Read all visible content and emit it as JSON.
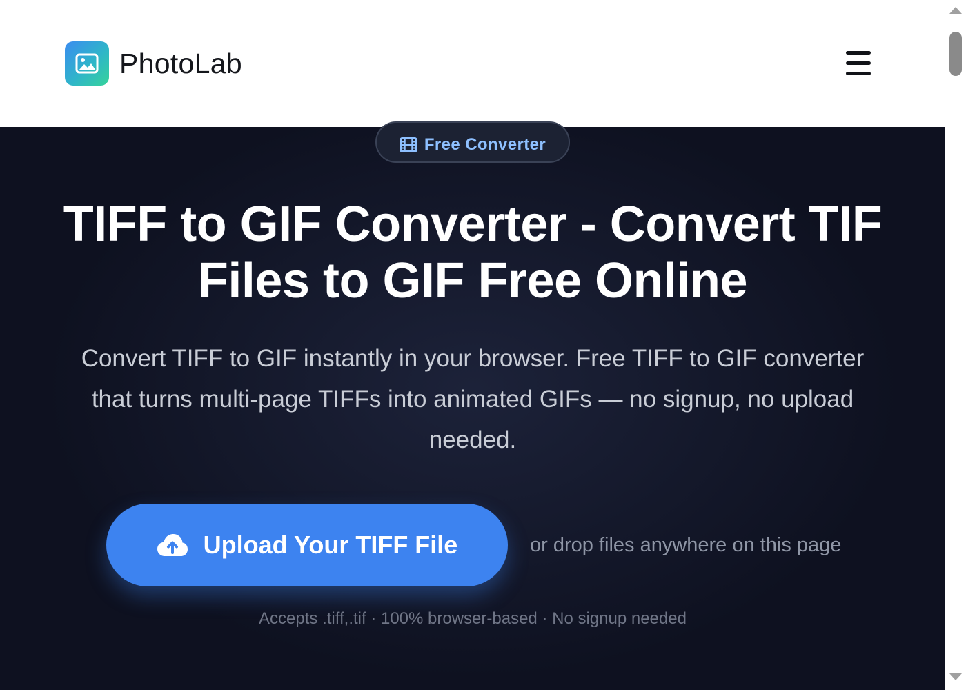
{
  "header": {
    "brand_name": "PhotoLab",
    "logo_icon": "image-icon",
    "menu_icon": "hamburger-menu-icon"
  },
  "hero": {
    "badge": {
      "icon": "film-icon",
      "label": "Free Converter"
    },
    "title": "TIFF to GIF Converter - Convert TIF Files to GIF Free Online",
    "subtitle": "Convert TIFF to GIF instantly in your browser. Free TIFF to GIF converter that turns multi-page TIFFs into animated GIFs — no signup, no upload needed.",
    "upload_button": {
      "icon": "cloud-upload-icon",
      "label": "Upload Your TIFF File"
    },
    "drop_hint": "or drop files anywhere on this page",
    "accepts_note": "Accepts .tiff,.tif · 100% browser-based · No signup needed"
  },
  "colors": {
    "accent": "#3d83f0",
    "hero_background": "#0e1120",
    "badge_text": "#8ec0ff"
  }
}
